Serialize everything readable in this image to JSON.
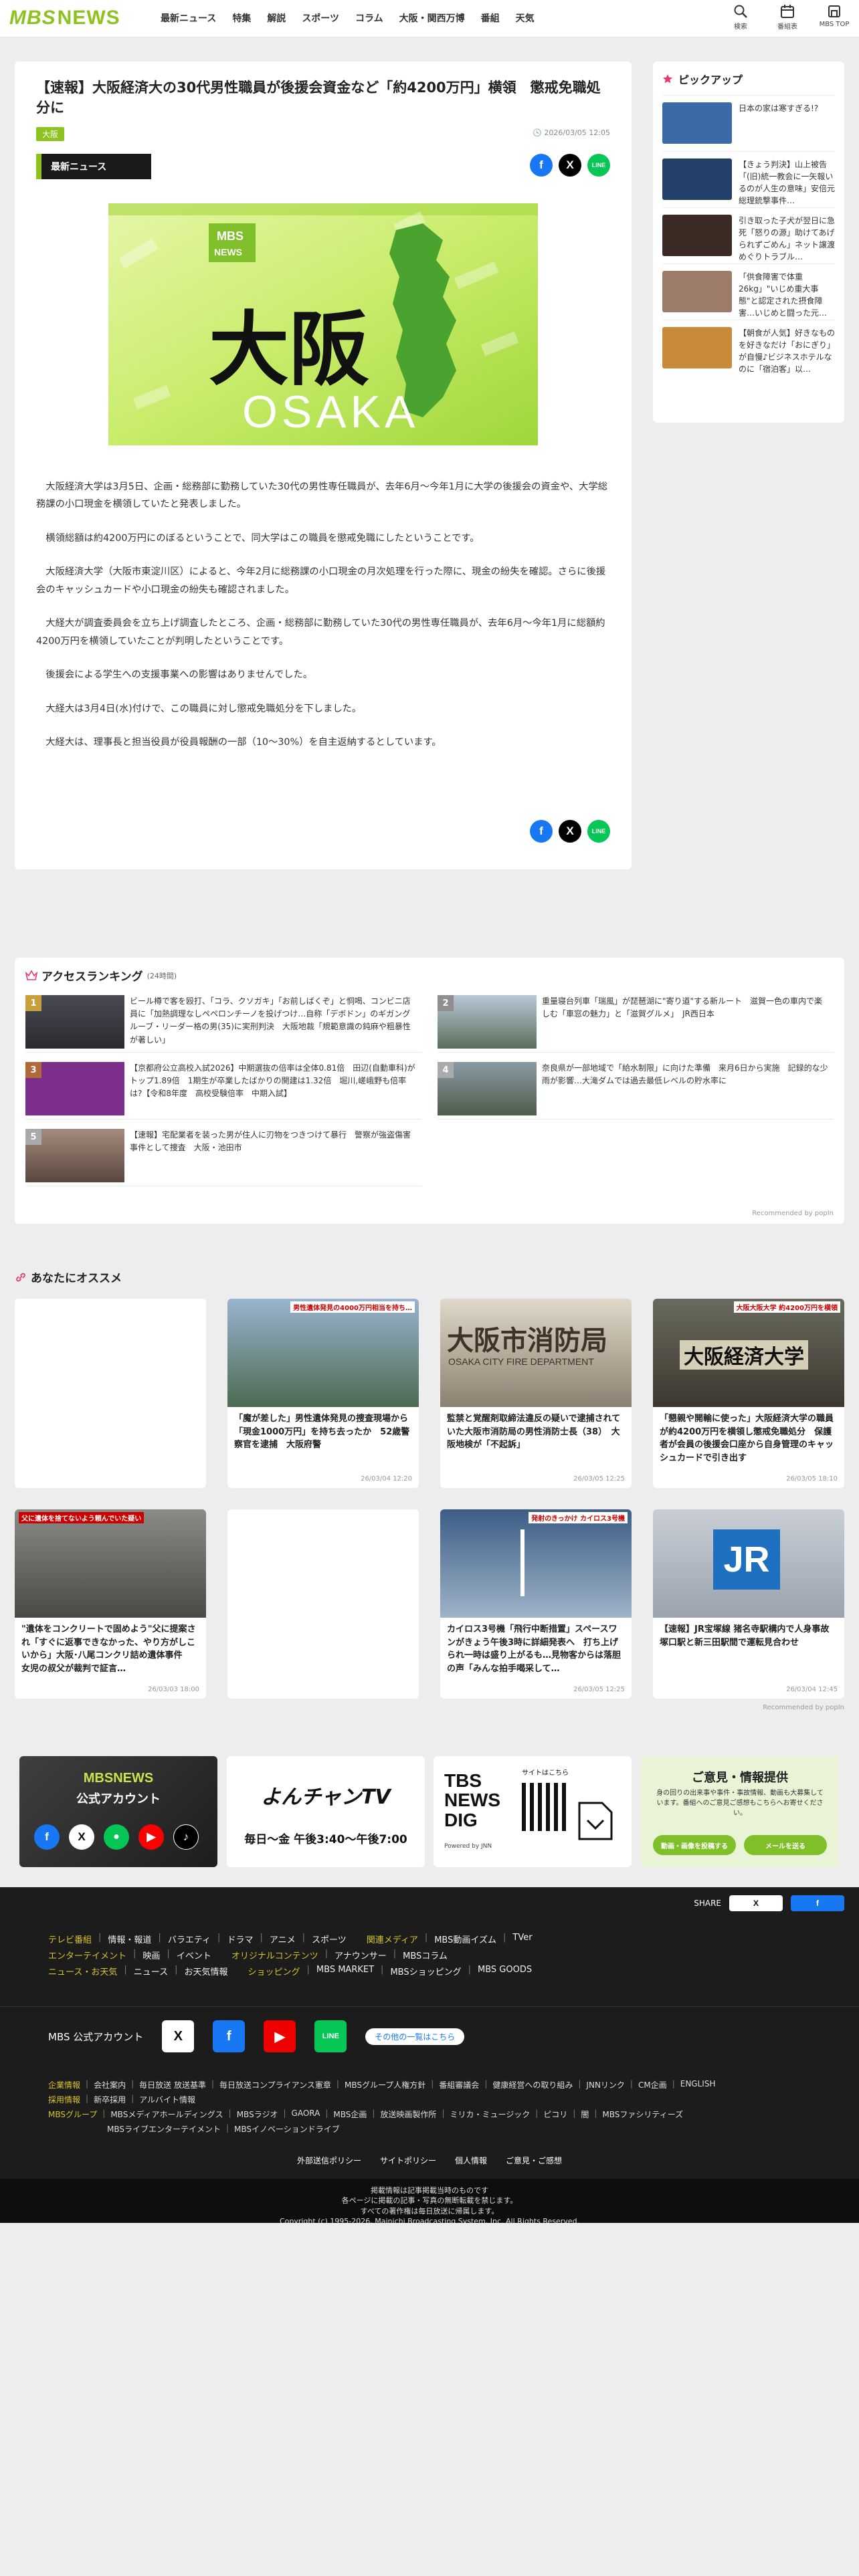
{
  "header": {
    "logo_mbs": "MBS",
    "logo_news": "NEWS",
    "nav": [
      "最新ニュース",
      "特集",
      "解説",
      "スポーツ",
      "コラム",
      "大阪・関西万博",
      "番組",
      "天気"
    ],
    "icons": [
      {
        "label": "検索",
        "icon": "search-icon"
      },
      {
        "label": "番組表",
        "icon": "calendar-icon"
      },
      {
        "label": "MBS TOP",
        "icon": "home-icon"
      }
    ]
  },
  "article": {
    "title": "【速報】大阪経済大の30代男性職員が後援会資金など「約4200万円」横領　懲戒免職処分に",
    "category": "大阪",
    "date": "2026/03/05 12:05",
    "section_label": "最新ニュース",
    "hero": {
      "kanji": "大阪",
      "roman": "OSAKA",
      "logo_mbs": "MBS",
      "logo_news": "NEWS"
    },
    "paragraphs": [
      "大阪経済大学は3月5日、企画・総務部に勤務していた30代の男性専任職員が、去年6月～今年1月に大学の後援会の資金や、大学総務課の小口現金を横領していたと発表しました。",
      "横領総額は約4200万円にのぼるということで、同大学はこの職員を懲戒免職にしたということです。",
      "大阪経済大学（大阪市東淀川区）によると、今年2月に総務課の小口現金の月次処理を行った際に、現金の紛失を確認。さらに後援会のキャッシュカードや小口現金の紛失も確認されました。",
      "大経大が調査委員会を立ち上げ調査したところ、企画・総務部に勤務していた30代の男性専任職員が、去年6月～今年1月に総額約4200万円を横領していたことが判明したということです。",
      "後援会による学生への支援事業への影響はありませんでした。",
      "大経大は3月4日(水)付けで、この職員に対し懲戒免職処分を下しました。",
      "大経大は、理事長と担当役員が役員報酬の一部（10～30%）を自主返納するとしています。"
    ],
    "share": {
      "fb": "f",
      "x": "X",
      "line": "LINE"
    }
  },
  "pickup": {
    "title": "ピックアップ",
    "items": [
      {
        "text": "日本の家は寒すぎる!?",
        "thumb": "#3c6aa8"
      },
      {
        "text": "【きょう判決】山上被告「(旧)統一教会に一矢報いるのが人生の意味」安倍元総理銃撃事件…",
        "thumb": "#23406b"
      },
      {
        "text": "引き取った子犬が翌日に急死「怒りの源」助けてあげられずごめん」ネット譲渡めぐりトラブル…",
        "thumb": "#3a2c24"
      },
      {
        "text": "「供食障害で体重26kg」\"いじめ重大事態\"と認定された摂食障害…いじめと闘った元…",
        "thumb": "#9c7b68"
      },
      {
        "text": "【朝食が人気】好きなものを好きなだけ「おにぎり」が自慢♪ビジネスホテルなのに「宿泊客」以…",
        "thumb": "#c98a3c"
      }
    ]
  },
  "ranking": {
    "title": "アクセスランキング",
    "period": "(24時間)",
    "items": [
      {
        "num": "1",
        "text": "ビール樽で客を殴打、「コラ、クソガキ」「お前しばくぞ」と恫喝、コンビニ店員に「加熱調理なしペペロンチーノを投げつけ…自称「デボドン」のギガングルーブ・リーダー格の男(35)に実刑判決　大阪地裁「規範意識の鈍麻や粗暴性が著しい」"
      },
      {
        "num": "2",
        "text": "重量寝台列車「瑞風」が琵琶湖に\"寄り道\"する新ルート　滋賀一色の車内で楽しむ「車窓の魅力」と「滋賀グルメ」　JR西日本"
      },
      {
        "num": "3",
        "text": "【京都府公立高校入試2026】中期選抜の倍率は全体0.81倍　田辺(自動車科)がトップ1.89倍　1期生が卒業したばかりの開建は1.32倍　堀川,嵯峨野も倍率は?【令和8年度　高校受験倍率　中期入試】"
      },
      {
        "num": "4",
        "text": "奈良県が一部地域で「給水制限」に向けた準備　来月6日から実施　記録的な少雨が影響…大滝ダムでは過去最低レベルの貯水率に"
      },
      {
        "num": "5",
        "text": "【速報】宅配業者を装った男が住人に刃物をつきつけて暴行　警察が強盗傷害事件として捜査　大阪・池田市"
      }
    ],
    "recommended": "Recommended by popIn"
  },
  "osusume": {
    "title": "あなたにオススメ",
    "cards": [
      {
        "text": "",
        "date": ""
      },
      {
        "text": "「魔が差した」男性遺体発見の捜査現場から「現金1000万円」を持ち去ったか　52歳警察官を逮捕　大阪府警",
        "date": "26/03/04 12:20"
      },
      {
        "text": "監禁と覚醒剤取締法違反の疑いで逮捕されていた大阪市消防局の男性消防士長（38）　大阪地検が「不起訴」",
        "date": "26/03/05 12:25"
      },
      {
        "text": "「懇親や開輸に使った」大阪経済大学の職員が約4200万円を横領し懲戒免職処分　保護者が会員の後援会口座から自身管理のキャッシュカードで引き出す",
        "date": "26/03/05 18:10"
      },
      {
        "text": "\"遺体をコンクリートで固めよう\"父に提案され「すぐに返事できなかった、やり方がしこいから」大阪･八尾コンクリ詰め遺体事件　女児の叔父が裁判で証言…",
        "date": "26/03/03 18:00"
      },
      {
        "text": "",
        "date": ""
      },
      {
        "text": "カイロス3号機「飛行中断措置」スペースワンがきょう午後3時に詳細発表へ　打ち上げられ一時は盛り上がるも…見物客からは落胆の声「みんな拍手喝采して…",
        "date": "26/03/05 12:25"
      },
      {
        "text": "【速報】JR宝塚線 猪名寺駅構内で人身事故　塚口駅と新三田駅間で運転見合わせ",
        "date": "26/03/04 12:45"
      }
    ],
    "card_badges": [
      "男性遺体発見の4000万円相当を持ち…",
      "大阪大阪大学 約4200万円を横領",
      "父に遺体を捨てないよう頼んでいた疑い",
      "発射のきっかけ カイロス3号機"
    ],
    "jr_label": "JR",
    "bldg_signs": [
      "大阪市消防局",
      "OSAKA CITY FIRE DEPARTMENT",
      "大阪経済大学"
    ],
    "recommended": "Recommended by popIn"
  },
  "banners": {
    "mbs_official": "MBSNEWS",
    "mbs_official_sub": "公式アカウント",
    "yon": "よんチャンTV",
    "yon_time": "毎日〜金 午後3:40〜午後7:00",
    "tbs": [
      "TBS",
      "NEWS",
      "DIG"
    ],
    "tbs_sub": "Powered by JNN",
    "tbs_note": "サイトはこちら",
    "opinion_title": "ご意見・情報提供",
    "opinion_desc": "身の回りの出来事や事件・事故情報、動画も大募集しています。番組へのご意見ご感想もこちらへお寄せください。",
    "opinion_btn1": "動画・画像を投稿する",
    "opinion_btn2": "メールを送る"
  },
  "footer": {
    "share_label": "SHARE",
    "lines": [
      [
        {
          "t": "テレビ番組",
          "y": true
        },
        {
          "t": "情報・報道"
        },
        {
          "t": "バラエティ"
        },
        {
          "t": "ドラマ"
        },
        {
          "t": "アニメ"
        },
        {
          "t": "スポーツ"
        },
        {
          "t": "関連メディア",
          "y": true
        },
        {
          "t": "MBS動画イズム"
        },
        {
          "t": "TVer"
        }
      ],
      [
        {
          "t": "エンターテイメント",
          "y": true
        },
        {
          "t": "映画"
        },
        {
          "t": "イベント"
        },
        {
          "t": "オリジナルコンテンツ",
          "y": true
        },
        {
          "t": "アナウンサー"
        },
        {
          "t": "MBSコラム"
        }
      ],
      [
        {
          "t": "ニュース・お天気",
          "y": true
        },
        {
          "t": "ニュース"
        },
        {
          "t": "お天気情報"
        },
        {
          "t": "ショッピング",
          "y": true
        },
        {
          "t": "MBS MARKET"
        },
        {
          "t": "MBSショッピング"
        },
        {
          "t": "MBS GOODS"
        }
      ]
    ],
    "official_label": "MBS 公式アカウント",
    "official_link": "その他の一覧はこちら",
    "corp_lines": [
      [
        {
          "t": "企業情報",
          "y": true
        },
        {
          "t": "会社案内"
        },
        {
          "t": "毎日放送 放送基準"
        },
        {
          "t": "毎日放送コンプライアンス憲章"
        },
        {
          "t": "MBSグループ人権方針"
        },
        {
          "t": "番組審議会"
        },
        {
          "t": "健康経営への取り組み"
        },
        {
          "t": "JNNリンク"
        },
        {
          "t": "CM企画"
        },
        {
          "t": "ENGLISH"
        }
      ],
      [
        {
          "t": "採用情報",
          "y": true
        },
        {
          "t": "新卒採用"
        },
        {
          "t": "アルバイト情報"
        }
      ],
      [
        {
          "t": "MBSグループ",
          "y": true
        },
        {
          "t": "MBSメディアホールディングス"
        },
        {
          "t": "MBSラジオ"
        },
        {
          "t": "GAORA"
        },
        {
          "t": "MBS企画"
        },
        {
          "t": "放送映画製作所"
        },
        {
          "t": "ミリカ・ミュージック"
        },
        {
          "t": "ピコリ"
        },
        {
          "t": "闇"
        },
        {
          "t": "MBSファシリティーズ"
        }
      ],
      [
        {
          "t": "MBSライブエンターテイメント"
        },
        {
          "t": "MBSイノベーションドライブ"
        }
      ]
    ],
    "policies": [
      "外部送信ポリシー",
      "サイトポリシー",
      "個人情報",
      "ご意見・ご感想"
    ],
    "copy1": "掲載情報は記事掲載当時のものです",
    "copy2": "各ページに掲載の記事・写真の無断転載を禁じます。",
    "copy3": "すべての著作権は毎日放送に帰属します。",
    "copy4": "Copyright (c) 1995-2026, Mainichi Broadcasting System, Inc. All Rights Reserved."
  }
}
